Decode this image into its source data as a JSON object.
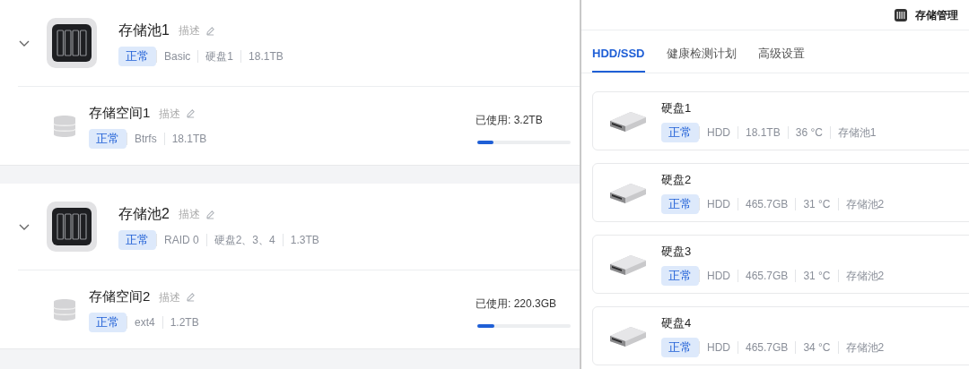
{
  "pools": [
    {
      "name": "存储池1",
      "description": "描述",
      "expanded": true,
      "status": "正常",
      "meta": [
        "Basic",
        "硬盘1",
        "18.1TB"
      ],
      "spaces": [
        {
          "name": "存储空间1",
          "description": "描述",
          "status": "正常",
          "meta": [
            "Btrfs",
            "18.1TB"
          ],
          "usage": "已使用: 3.2TB",
          "level": 0.177
        }
      ]
    },
    {
      "name": "存储池2",
      "description": "描述",
      "expanded": true,
      "status": "正常",
      "meta": [
        "RAID 0",
        "硬盘2、3、4",
        "1.3TB"
      ],
      "spaces": [
        {
          "name": "存储空间2",
          "description": "描述",
          "status": "正常",
          "meta": [
            "ext4",
            "1.2TB"
          ],
          "usage": "已使用: 220.3GB",
          "level": 0.18
        }
      ]
    }
  ],
  "window": {
    "title": "存储管理"
  },
  "tabs": [
    {
      "label": "HDD/SSD",
      "selected": true
    },
    {
      "label": "健康检测计划",
      "selected": false
    },
    {
      "label": "高级设置",
      "selected": false
    }
  ],
  "disks": [
    {
      "name": "硬盘1",
      "status": "正常",
      "meta": [
        "HDD",
        "18.1TB",
        "36 °C",
        "存储池1"
      ]
    },
    {
      "name": "硬盘2",
      "status": "正常",
      "meta": [
        "HDD",
        "465.7GB",
        "31 °C",
        "存储池2"
      ]
    },
    {
      "name": "硬盘3",
      "status": "正常",
      "meta": [
        "HDD",
        "465.7GB",
        "31 °C",
        "存储池2"
      ]
    },
    {
      "name": "硬盘4",
      "status": "正常",
      "meta": [
        "HDD",
        "465.7GB",
        "34 °C",
        "存储池2"
      ]
    }
  ]
}
